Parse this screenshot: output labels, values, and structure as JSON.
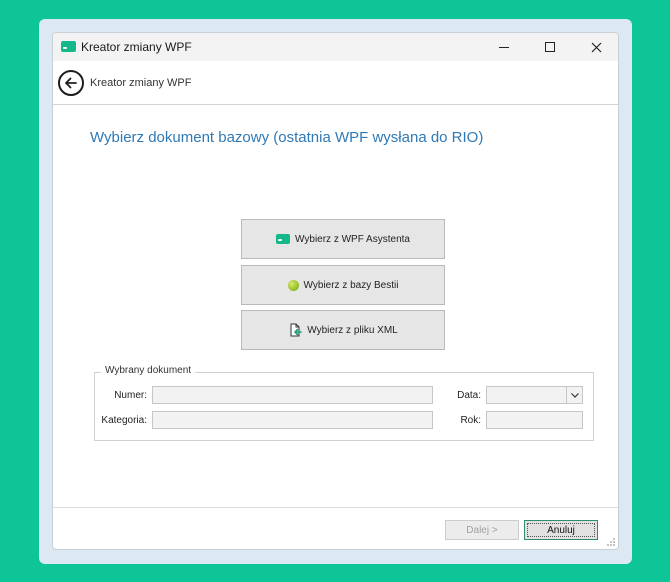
{
  "window": {
    "title": "Kreator zmiany WPF",
    "controls": {
      "minimize": "minimize",
      "maximize": "maximize",
      "close": "close"
    }
  },
  "nav": {
    "title": "Kreator zmiany WPF"
  },
  "main": {
    "heading": "Wybierz dokument bazowy (ostatnia WPF wysłana do RIO)",
    "options": [
      {
        "label": "Wybierz z WPF Asystenta",
        "icon": "wpf-card-icon"
      },
      {
        "label": "Wybierz z bazy Bestii",
        "icon": "bestia-ball-icon"
      },
      {
        "label": "Wybierz z pliku XML",
        "icon": "xml-file-import-icon"
      }
    ]
  },
  "selected_document": {
    "legend": "Wybrany dokument",
    "numer_label": "Numer:",
    "numer_value": "",
    "kategoria_label": "Kategoria:",
    "kategoria_value": "",
    "data_label": "Data:",
    "data_value": "",
    "rok_label": "Rok:",
    "rok_value": ""
  },
  "footer": {
    "next_label": "Dalej >",
    "cancel_label": "Anuluj"
  },
  "colors": {
    "background": "#0dc596",
    "accent_heading": "#2f79b5",
    "app_icon": "#14b88a"
  }
}
